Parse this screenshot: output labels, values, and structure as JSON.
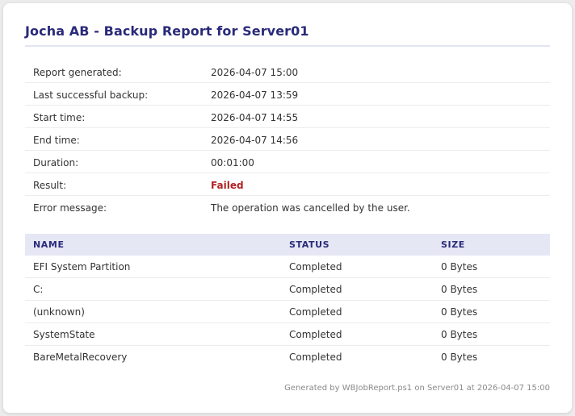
{
  "report": {
    "title": "Jocha AB - Backup Report for Server01",
    "info": [
      {
        "label": "Report generated:",
        "value": "2026-04-07 15:00"
      },
      {
        "label": "Last successful backup:",
        "value": "2026-04-07 13:59"
      },
      {
        "label": "Start time:",
        "value": "2026-04-07 14:55"
      },
      {
        "label": "End time:",
        "value": "2026-04-07 14:56"
      },
      {
        "label": "Duration:",
        "value": "00:01:00"
      },
      {
        "label": "Result:",
        "value": "Failed"
      },
      {
        "label": "Error message:",
        "value": "The operation was cancelled by the user."
      }
    ],
    "table": {
      "headers": [
        "NAME",
        "STATUS",
        "SIZE"
      ],
      "rows": [
        [
          "EFI System Partition",
          "Completed",
          "0 Bytes"
        ],
        [
          "C:",
          "Completed",
          "0 Bytes"
        ],
        [
          "(unknown)",
          "Completed",
          "0 Bytes"
        ],
        [
          "SystemState",
          "Completed",
          "0 Bytes"
        ],
        [
          "BareMetalRecovery",
          "Completed",
          "0 Bytes"
        ]
      ]
    },
    "footer": "Generated by WBJobReport.ps1 on Server01 at 2026-04-07 15:00"
  },
  "colors": {
    "title": "#2a2a7a",
    "header_bg": "#e6e7f5",
    "failed": "#b22222"
  }
}
